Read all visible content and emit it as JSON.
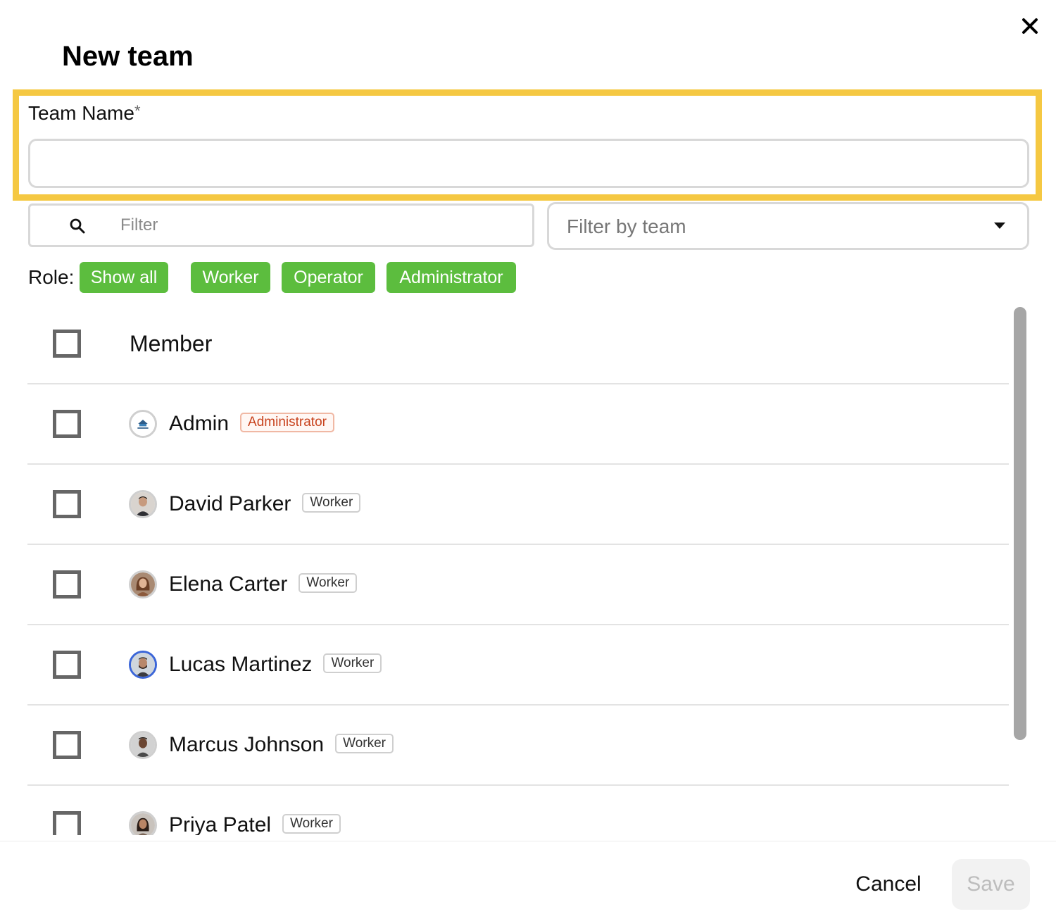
{
  "dialog": {
    "title": "New team",
    "close_icon": "close-icon"
  },
  "team_name": {
    "label": "Team Name",
    "required_mark": "*",
    "value": "",
    "highlight_color": "#f5c842"
  },
  "filter": {
    "placeholder": "Filter",
    "icon": "search-icon"
  },
  "team_select": {
    "placeholder": "Filter by team",
    "icon": "caret-down-icon"
  },
  "roles": {
    "label": "Role:",
    "chip_color": "#5cbd3e",
    "chips": [
      "Show all",
      "Worker",
      "Operator",
      "Administrator"
    ]
  },
  "table": {
    "header": "Member",
    "members": [
      {
        "name": "Admin",
        "role": "Administrator"
      },
      {
        "name": "David Parker",
        "role": "Worker"
      },
      {
        "name": "Elena Carter",
        "role": "Worker"
      },
      {
        "name": "Lucas Martinez",
        "role": "Worker"
      },
      {
        "name": "Marcus Johnson",
        "role": "Worker"
      },
      {
        "name": "Priya Patel",
        "role": "Worker"
      }
    ]
  },
  "footer": {
    "cancel_label": "Cancel",
    "save_label": "Save"
  }
}
